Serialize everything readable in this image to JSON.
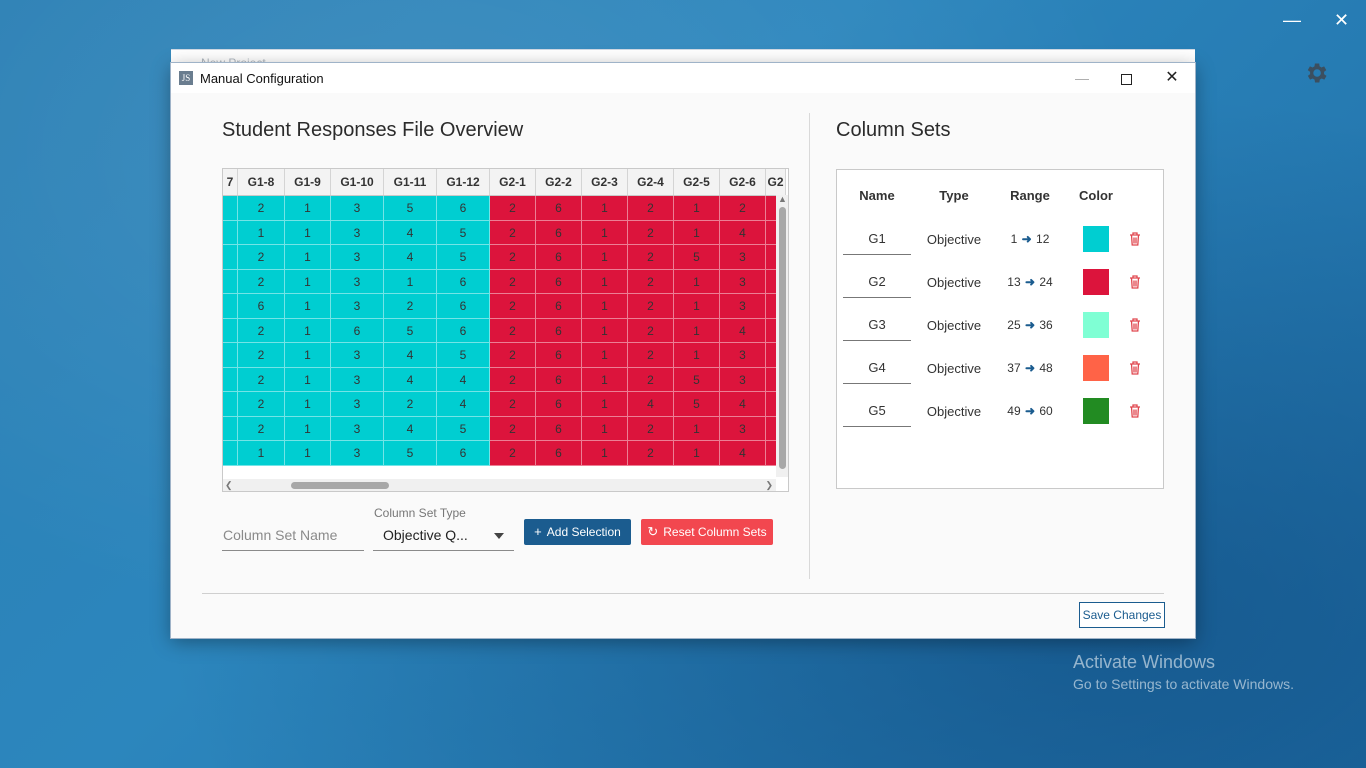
{
  "desktop": {
    "activate_title": "Activate Windows",
    "activate_sub": "Go to Settings to activate Windows."
  },
  "back_window": {
    "title": "New Project"
  },
  "dialog": {
    "title": "Manual Configuration",
    "app_icon": "JS"
  },
  "overview": {
    "title": "Student Responses File Overview",
    "columns": [
      {
        "label": "7",
        "width": 15,
        "color": "c1"
      },
      {
        "label": "G1-8",
        "width": 47,
        "color": "c1"
      },
      {
        "label": "G1-9",
        "width": 46,
        "color": "c1"
      },
      {
        "label": "G1-10",
        "width": 53,
        "color": "c1"
      },
      {
        "label": "G1-11",
        "width": 53,
        "color": "c1"
      },
      {
        "label": "G1-12",
        "width": 53,
        "color": "c1"
      },
      {
        "label": "G2-1",
        "width": 46,
        "color": "c2"
      },
      {
        "label": "G2-2",
        "width": 46,
        "color": "c2"
      },
      {
        "label": "G2-3",
        "width": 46,
        "color": "c2"
      },
      {
        "label": "G2-4",
        "width": 46,
        "color": "c2"
      },
      {
        "label": "G2-5",
        "width": 46,
        "color": "c2"
      },
      {
        "label": "G2-6",
        "width": 46,
        "color": "c2"
      },
      {
        "label": "G2",
        "width": 20,
        "color": "c2"
      }
    ],
    "rows": [
      [
        "",
        "2",
        "1",
        "3",
        "5",
        "6",
        "2",
        "6",
        "1",
        "2",
        "1",
        "2",
        ""
      ],
      [
        "",
        "1",
        "1",
        "3",
        "4",
        "5",
        "2",
        "6",
        "1",
        "2",
        "1",
        "4",
        ""
      ],
      [
        "",
        "2",
        "1",
        "3",
        "4",
        "5",
        "2",
        "6",
        "1",
        "2",
        "5",
        "3",
        ""
      ],
      [
        "",
        "2",
        "1",
        "3",
        "1",
        "6",
        "2",
        "6",
        "1",
        "2",
        "1",
        "3",
        ""
      ],
      [
        "",
        "6",
        "1",
        "3",
        "2",
        "6",
        "2",
        "6",
        "1",
        "2",
        "1",
        "3",
        ""
      ],
      [
        "",
        "2",
        "1",
        "6",
        "5",
        "6",
        "2",
        "6",
        "1",
        "2",
        "1",
        "4",
        ""
      ],
      [
        "",
        "2",
        "1",
        "3",
        "4",
        "5",
        "2",
        "6",
        "1",
        "2",
        "1",
        "3",
        ""
      ],
      [
        "",
        "2",
        "1",
        "3",
        "4",
        "4",
        "2",
        "6",
        "1",
        "2",
        "5",
        "3",
        ""
      ],
      [
        "",
        "2",
        "1",
        "3",
        "2",
        "4",
        "2",
        "6",
        "1",
        "4",
        "5",
        "4",
        ""
      ],
      [
        "",
        "2",
        "1",
        "3",
        "4",
        "5",
        "2",
        "6",
        "1",
        "2",
        "1",
        "3",
        ""
      ],
      [
        "",
        "1",
        "1",
        "3",
        "5",
        "6",
        "2",
        "6",
        "1",
        "2",
        "1",
        "4",
        ""
      ]
    ]
  },
  "form": {
    "name_placeholder": "Column Set Name",
    "type_label": "Column Set Type",
    "type_value": "Objective Q...",
    "add_label": "Add Selection",
    "reset_label": "Reset Column Sets"
  },
  "column_sets": {
    "title": "Column Sets",
    "headers": {
      "name": "Name",
      "type": "Type",
      "range": "Range",
      "color": "Color"
    },
    "items": [
      {
        "name": "G1",
        "type": "Objective",
        "from": "1",
        "to": "12",
        "color": "#00CED1"
      },
      {
        "name": "G2",
        "type": "Objective",
        "from": "13",
        "to": "24",
        "color": "#DC143C"
      },
      {
        "name": "G3",
        "type": "Objective",
        "from": "25",
        "to": "36",
        "color": "#7FFFD4"
      },
      {
        "name": "G4",
        "type": "Objective",
        "from": "37",
        "to": "48",
        "color": "#FF6347"
      },
      {
        "name": "G5",
        "type": "Objective",
        "from": "49",
        "to": "60",
        "color": "#228B22"
      }
    ]
  },
  "footer": {
    "save_label": "Save Changes"
  }
}
